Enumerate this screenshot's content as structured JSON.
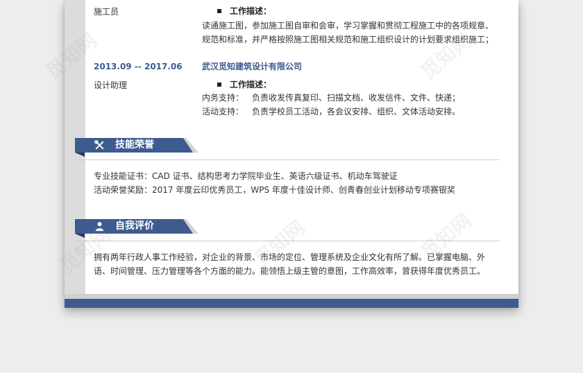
{
  "colors": {
    "accent": "#3d5b8f",
    "band": "#d4d4d4"
  },
  "work": [
    {
      "role": "施工员",
      "desc_title": "工作描述：",
      "lines": [
        "读通施工图，参加施工图自审和会审，学习掌握和贯彻工程施工中的各项规章、",
        "规范和标准，并严格按照施工图相关规范和施工组织设计的计划要求组织施工；"
      ]
    },
    {
      "period": "2013.09 -- 2017.06",
      "company": "武汉觅知建筑设计有限公司",
      "role": "设计助理",
      "desc_title": "工作描述：",
      "items": [
        {
          "label": "内务支持：",
          "text": "负责收发传真复印、扫描文档、收发信件、文件、快递；"
        },
        {
          "label": "活动支持：",
          "text": "负责学校员工活动，各会议安排、组织、文体活动安排。"
        }
      ]
    }
  ],
  "skills": {
    "title": "技能荣誉",
    "icon": "tools-icon",
    "lines": [
      "专业技能证书：CAD 证书、结构思考力学院毕业生、英语六级证书、机动车驾驶证",
      "活动荣誉奖励：2017 年度云印优秀员工，WPS 年度十佳设计师、创青春创业计划移动专项赛银奖"
    ]
  },
  "self": {
    "title": "自我评价",
    "icon": "person-icon",
    "lines": [
      "拥有两年行政人事工作经验，对企业的背景、市场的定位、管理系统及企业文化有所了解。已掌握电脑、外",
      "语、时间管理、压力管理等各个方面的能力。能领悟上级主管的意图，工作高效率，曾获得年度优秀员工。"
    ]
  },
  "watermark": "觅知网"
}
